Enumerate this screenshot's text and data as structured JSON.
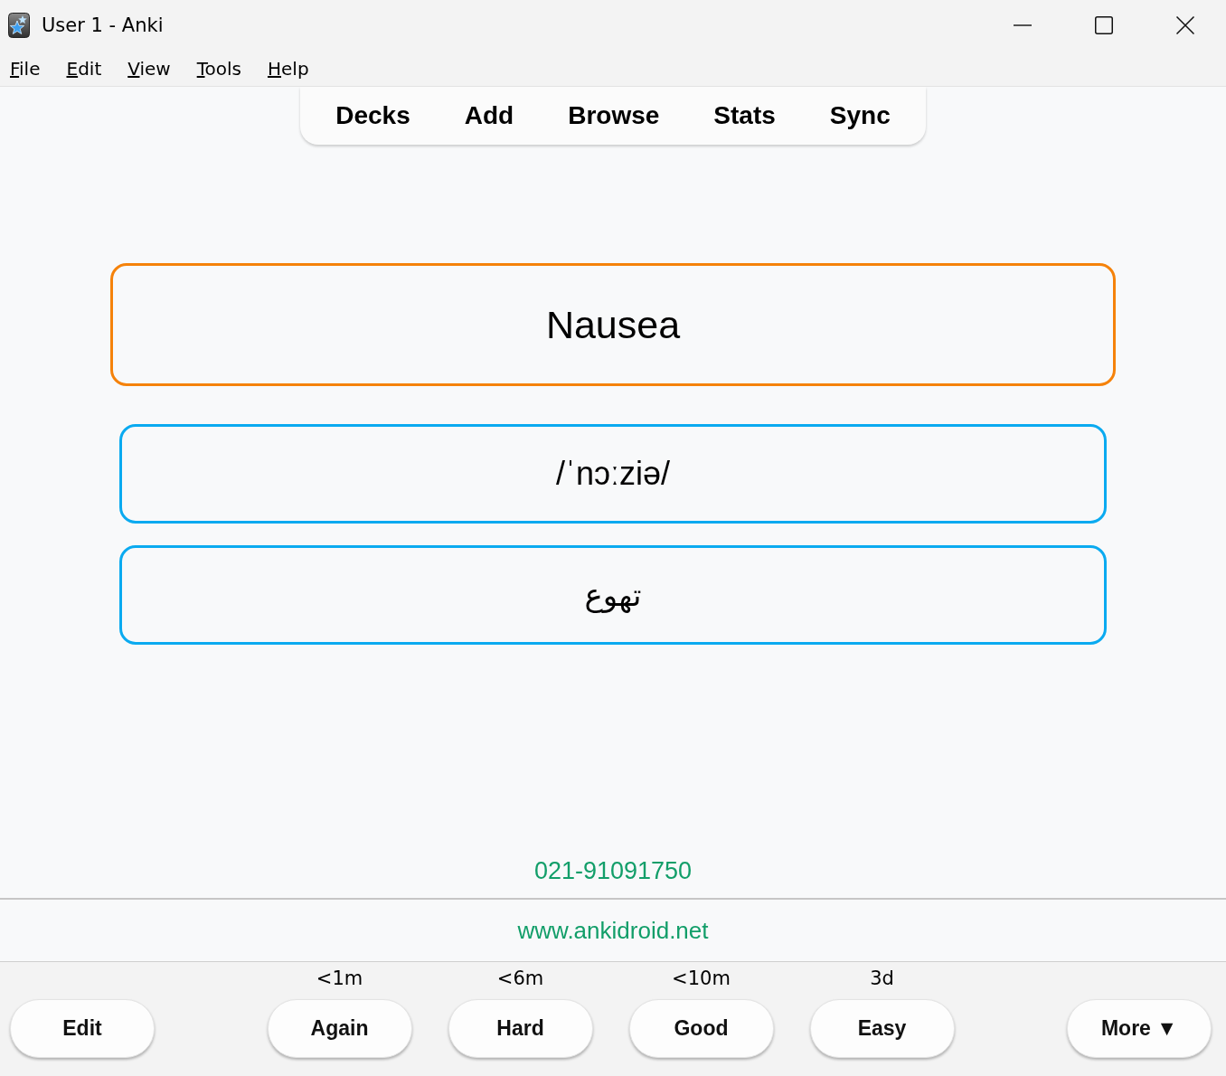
{
  "window": {
    "title": "User 1 - Anki"
  },
  "menu": [
    "File",
    "Edit",
    "View",
    "Tools",
    "Help"
  ],
  "toolbar": [
    "Decks",
    "Add",
    "Browse",
    "Stats",
    "Sync"
  ],
  "card": {
    "front": "Nausea",
    "back_fields": [
      {
        "kind": "latin",
        "text": "/ˈnɔːziə/"
      },
      {
        "kind": "rtl",
        "text": "تهوع"
      }
    ],
    "footer": "021-91091750"
  },
  "footer_link": "www.ankidroid.net",
  "bottom_bar": {
    "edit": "Edit",
    "answers": [
      {
        "interval": "<1m",
        "label": "Again"
      },
      {
        "interval": "<6m",
        "label": "Hard"
      },
      {
        "interval": "<10m",
        "label": "Good"
      },
      {
        "interval": "3d",
        "label": "Easy"
      }
    ],
    "more": "More ▼"
  }
}
